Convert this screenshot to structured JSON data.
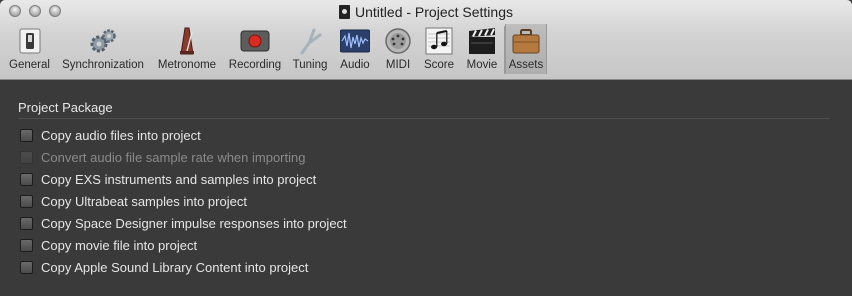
{
  "window": {
    "title": "Untitled - Project Settings"
  },
  "toolbar": {
    "items": [
      {
        "label": "General",
        "icon": "general-switch-icon"
      },
      {
        "label": "Synchronization",
        "icon": "gears-icon"
      },
      {
        "label": "Metronome",
        "icon": "metronome-icon"
      },
      {
        "label": "Recording",
        "icon": "record-icon"
      },
      {
        "label": "Tuning",
        "icon": "tuning-fork-icon"
      },
      {
        "label": "Audio",
        "icon": "audio-waveform-icon"
      },
      {
        "label": "MIDI",
        "icon": "midi-connector-icon"
      },
      {
        "label": "Score",
        "icon": "score-notes-icon"
      },
      {
        "label": "Movie",
        "icon": "clapperboard-icon"
      },
      {
        "label": "Assets",
        "icon": "briefcase-icon"
      }
    ],
    "selected": "Assets"
  },
  "section": {
    "title": "Project Package"
  },
  "options": [
    {
      "label": "Copy audio files into project",
      "checked": false,
      "enabled": true
    },
    {
      "label": "Convert audio file sample rate when importing",
      "checked": false,
      "enabled": false
    },
    {
      "label": "Copy EXS instruments and samples into project",
      "checked": false,
      "enabled": true
    },
    {
      "label": "Copy Ultrabeat samples into project",
      "checked": false,
      "enabled": true
    },
    {
      "label": "Copy Space Designer impulse responses into project",
      "checked": false,
      "enabled": true
    },
    {
      "label": "Copy movie file into project",
      "checked": false,
      "enabled": true
    },
    {
      "label": "Copy Apple Sound Library Content into project",
      "checked": false,
      "enabled": true
    }
  ],
  "colors": {
    "background": "#3a3a3a",
    "text": "#e6e6e6",
    "disabled_text": "#8a8a8a",
    "titlebar": "#d4d4d4"
  }
}
